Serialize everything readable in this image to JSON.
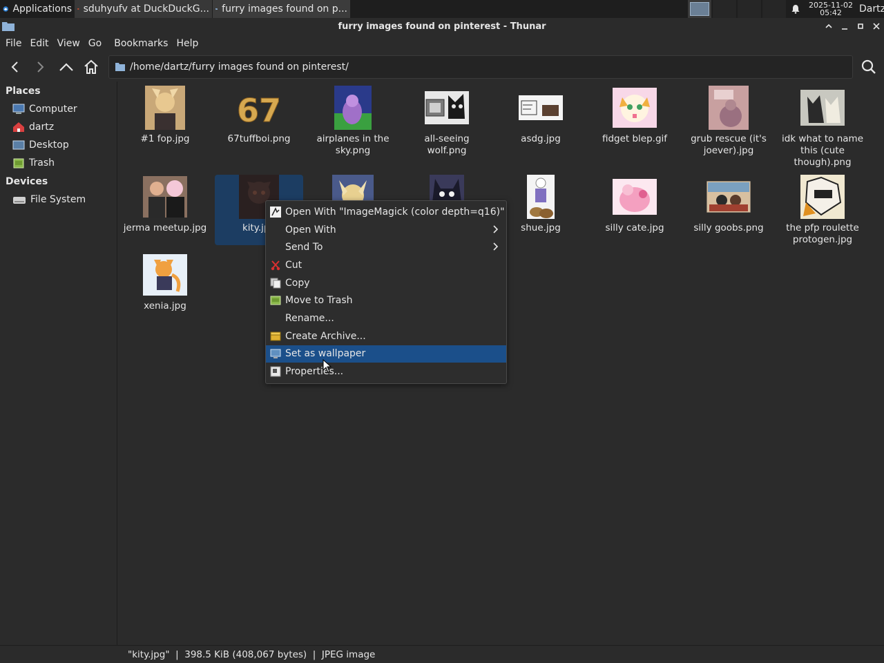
{
  "panel": {
    "applications_label": "Applications",
    "tasks": [
      {
        "label": "sduhyufv at DuckDuckG..."
      },
      {
        "label": "furry images found on p..."
      }
    ],
    "clock_date": "2025-11-02",
    "clock_time": "05:42",
    "user": "Dartz"
  },
  "window": {
    "title": "furry images found on pinterest - Thunar"
  },
  "menubar": {
    "file": "File",
    "edit": "Edit",
    "view": "View",
    "go": "Go",
    "bookmarks": "Bookmarks",
    "help": "Help"
  },
  "toolbar": {
    "path": "/home/dartz/furry images found on pinterest/"
  },
  "sidebar": {
    "places_heading": "Places",
    "places": [
      {
        "label": "Computer"
      },
      {
        "label": "dartz"
      },
      {
        "label": "Desktop"
      },
      {
        "label": "Trash"
      }
    ],
    "devices_heading": "Devices",
    "devices": [
      {
        "label": "File System"
      }
    ]
  },
  "files": [
    {
      "label": "#1 fop.jpg"
    },
    {
      "label": "67tuffboi.png"
    },
    {
      "label": "airplanes in the sky.png"
    },
    {
      "label": "all-seeing wolf.png"
    },
    {
      "label": "asdg.jpg"
    },
    {
      "label": "fidget blep.gif"
    },
    {
      "label": "grub rescue (it's joever).jpg"
    },
    {
      "label": "idk what to name this (cute though).png"
    },
    {
      "label": "jerma meetup.jpg"
    },
    {
      "label": "kity.jpg"
    },
    {
      "label": ""
    },
    {
      "label": ""
    },
    {
      "label": "shue.jpg"
    },
    {
      "label": "silly cate.jpg"
    },
    {
      "label": "silly goobs.png"
    },
    {
      "label": "the pfp roulette protogen.jpg"
    },
    {
      "label": "xenia.jpg"
    }
  ],
  "thumb_67_text": "67",
  "context_menu": {
    "open_with_imagemagick": "Open With \"ImageMagick (color depth=q16)\"",
    "open_with": "Open With",
    "send_to": "Send To",
    "cut": "Cut",
    "copy": "Copy",
    "move_to_trash": "Move to Trash",
    "rename": "Rename...",
    "create_archive": "Create Archive...",
    "set_as_wallpaper": "Set as wallpaper",
    "properties": "Properties..."
  },
  "statusbar": {
    "text": "\"kity.jpg\"  |  398.5 KiB (408,067 bytes)  |  JPEG image"
  }
}
